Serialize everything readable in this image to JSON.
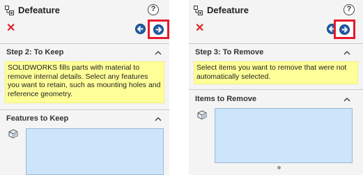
{
  "left_panel": {
    "title": "Defeature",
    "help_label": "?",
    "close_label": "✕",
    "step_title": "Step 2: To Keep",
    "note_text": "SOLIDWORKS fills parts with material to remove internal details. Select any features you want to retain, such as mounting holes and reference geometry.",
    "list_title": "Features to Keep"
  },
  "right_panel": {
    "title": "Defeature",
    "help_label": "?",
    "close_label": "✕",
    "step_title": "Step 3: To Remove",
    "note_text": "Select items you want to remove that were not automatically selected.",
    "list_title": "Items to Remove"
  },
  "icons": {
    "feature": "defeature-icon",
    "help": "help-icon",
    "close": "close-icon",
    "back": "back-arrow-icon",
    "next": "next-arrow-icon",
    "collapse": "chevron-up-icon",
    "body": "cube-icon"
  },
  "colors": {
    "highlight_border": "#e8192c",
    "nav_button": "#1f5ea8",
    "note_background": "#ffff99",
    "listbox_background": "#cde5fb",
    "close_x": "#e0242a"
  }
}
